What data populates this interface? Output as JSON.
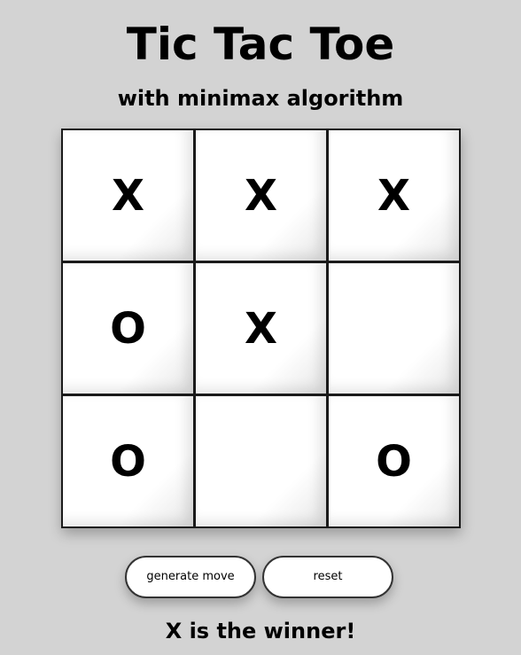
{
  "header": {
    "title": "Tic Tac Toe",
    "subtitle": "with minimax algorithm"
  },
  "board": {
    "cells": [
      "X",
      "X",
      "X",
      "O",
      "X",
      "",
      "O",
      "",
      "O"
    ]
  },
  "controls": {
    "generate_label": "generate move",
    "reset_label": "reset"
  },
  "status": {
    "message": "X is the winner!"
  },
  "colors": {
    "background": "#d3d3d3",
    "cell": "#ffffff",
    "text": "#000000"
  }
}
